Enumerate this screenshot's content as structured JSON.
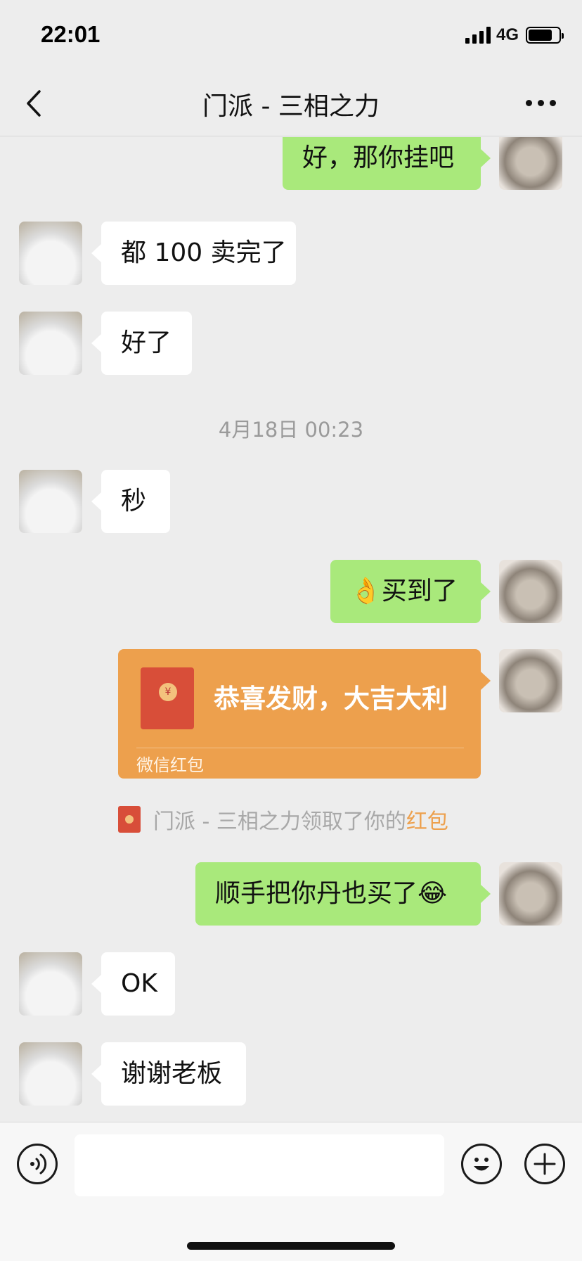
{
  "status_bar": {
    "time": "22:01",
    "network": "4G"
  },
  "header": {
    "title": "门派 - 三相之力"
  },
  "messages": [
    {
      "side": "out",
      "text": "好，那你挂吧"
    },
    {
      "side": "in",
      "text": "都 100 卖完了"
    },
    {
      "side": "in",
      "text": "好了"
    },
    {
      "side": "in",
      "text": "秒"
    },
    {
      "side": "out",
      "emoji": "👌",
      "text": "买到了"
    },
    {
      "side": "out",
      "text": "顺手把你丹也买了",
      "emoji": "😂"
    },
    {
      "side": "in",
      "text": "OK"
    },
    {
      "side": "in",
      "text": "谢谢老板"
    }
  ],
  "timestamp": "4月18日 00:23",
  "red_packet": {
    "title": "恭喜发财，大吉大利",
    "label": "微信红包",
    "seal": "¥"
  },
  "system_message": {
    "prefix": "门派 - 三相之力领取了你的",
    "link": "红包"
  },
  "colors": {
    "background": "#ededed",
    "outgoing_bubble": "#a9e97b",
    "incoming_bubble": "#ffffff",
    "red_packet": "#eda04d"
  },
  "icons": [
    "back-icon",
    "more-icon",
    "voice-icon",
    "emoji-icon",
    "plus-icon"
  ]
}
